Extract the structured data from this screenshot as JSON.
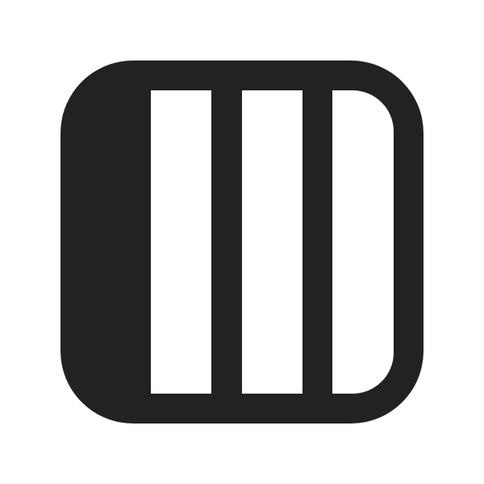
{
  "icon": {
    "name": "column-view-icon",
    "colors": {
      "foreground": "#222222",
      "background": "#ffffff"
    }
  }
}
